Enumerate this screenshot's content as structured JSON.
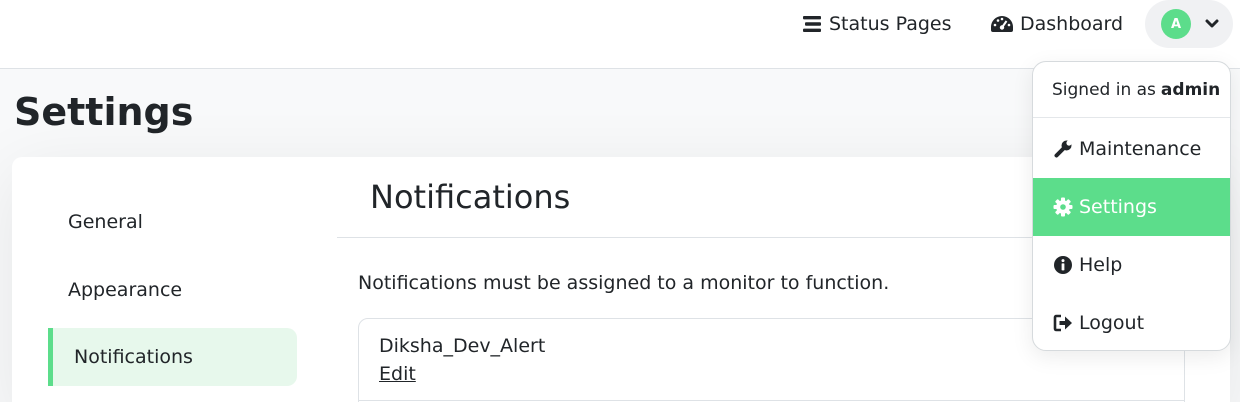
{
  "header": {
    "status_pages_label": "Status Pages",
    "dashboard_label": "Dashboard",
    "avatar_initial": "A"
  },
  "page": {
    "title": "Settings"
  },
  "sidebar": {
    "items": [
      {
        "label": "General"
      },
      {
        "label": "Appearance"
      },
      {
        "label": "Notifications",
        "active": true
      }
    ]
  },
  "main": {
    "section_title": "Notifications",
    "info_text": "Notifications must be assigned to a monitor to function.",
    "notifications": [
      {
        "name": "Diksha_Dev_Alert",
        "edit_label": "Edit"
      }
    ]
  },
  "dropdown": {
    "signed_in_prefix": "Signed in as",
    "username": "admin",
    "items": [
      {
        "label": "Maintenance",
        "icon": "wrench-icon"
      },
      {
        "label": "Settings",
        "icon": "cog-icon",
        "active": true
      },
      {
        "label": "Help",
        "icon": "info-circle-icon"
      },
      {
        "label": "Logout",
        "icon": "sign-out-icon"
      }
    ]
  },
  "colors": {
    "accent": "#5cdd8b",
    "active_bg": "#e7f8ec"
  }
}
